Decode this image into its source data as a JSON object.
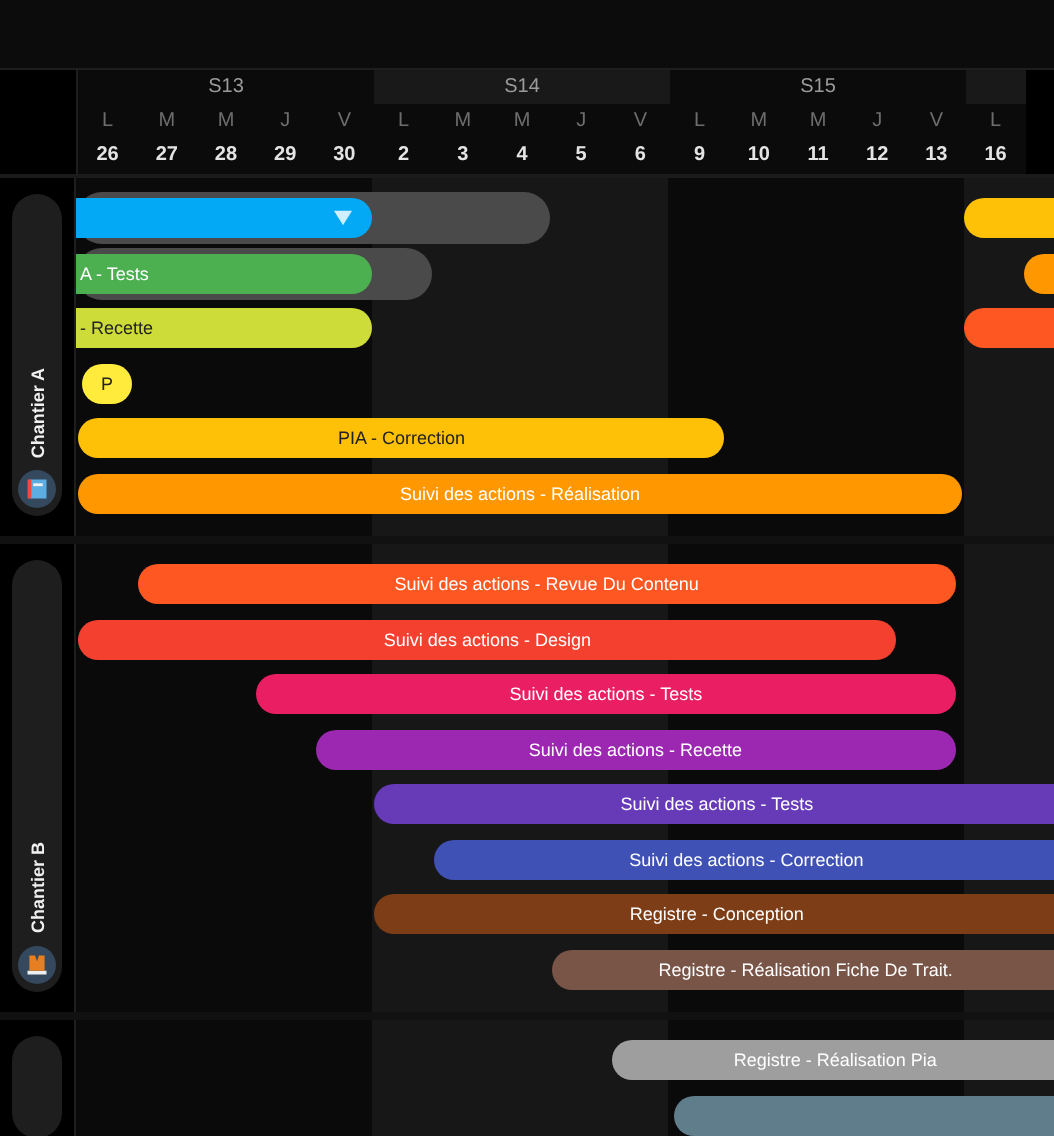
{
  "timeline": {
    "weeks": [
      {
        "label": "S13",
        "days": [
          {
            "letter": "L",
            "number": "26"
          },
          {
            "letter": "M",
            "number": "27"
          },
          {
            "letter": "M",
            "number": "28"
          },
          {
            "letter": "J",
            "number": "29"
          },
          {
            "letter": "V",
            "number": "30"
          }
        ]
      },
      {
        "label": "S14",
        "days": [
          {
            "letter": "L",
            "number": "2"
          },
          {
            "letter": "M",
            "number": "3"
          },
          {
            "letter": "M",
            "number": "4"
          },
          {
            "letter": "J",
            "number": "5"
          },
          {
            "letter": "V",
            "number": "6"
          }
        ]
      },
      {
        "label": "S15",
        "days": [
          {
            "letter": "L",
            "number": "9"
          },
          {
            "letter": "M",
            "number": "10"
          },
          {
            "letter": "M",
            "number": "11"
          },
          {
            "letter": "J",
            "number": "12"
          },
          {
            "letter": "V",
            "number": "13"
          }
        ]
      },
      {
        "days": [
          {
            "letter": "L",
            "number": "16"
          }
        ]
      }
    ]
  },
  "groups": [
    {
      "name": "Chantier A",
      "rows": [
        {
          "bars": [
            {
              "color": "#03a9f4",
              "dropdown": true
            },
            {
              "color": "#ffc107"
            }
          ]
        },
        {
          "bars": [
            {
              "label": "A - Tests",
              "color": "#4caf50"
            },
            {
              "color": "#ff9800"
            }
          ]
        },
        {
          "bars": [
            {
              "label": "- Recette",
              "color": "#cddc39"
            },
            {
              "color": "#ff5722"
            }
          ]
        },
        {
          "bars": [
            {
              "label": "P",
              "color": "#ffeb3b"
            }
          ]
        },
        {
          "bars": [
            {
              "label": "PIA - Correction",
              "color": "#ffc107"
            }
          ]
        },
        {
          "bars": [
            {
              "label": "Suivi des actions - Réalisation",
              "color": "#ff9800"
            }
          ]
        }
      ]
    },
    {
      "name": "Chantier B",
      "rows": [
        {
          "bars": [
            {
              "label": "Suivi des actions - Revue Du Contenu",
              "color": "#ff5722"
            }
          ]
        },
        {
          "bars": [
            {
              "label": "Suivi des actions - Design",
              "color": "#f4402f"
            }
          ]
        },
        {
          "bars": [
            {
              "label": "Suivi des actions - Tests",
              "color": "#e91e63"
            }
          ]
        },
        {
          "bars": [
            {
              "label": "Suivi des actions - Recette",
              "color": "#9c27b0"
            }
          ]
        },
        {
          "bars": [
            {
              "label": "Suivi des actions - Tests",
              "color": "#673ab7"
            }
          ]
        },
        {
          "bars": [
            {
              "label": "Suivi des actions - Correction",
              "color": "#3f51b5"
            }
          ]
        },
        {
          "bars": [
            {
              "label": "Registre - Conception",
              "color": "#7d3e17"
            }
          ]
        },
        {
          "bars": [
            {
              "label": "Registre - Réalisation Fiche De Trait.",
              "color": "#795548"
            }
          ]
        }
      ]
    },
    {
      "rows": [
        {
          "bars": [
            {
              "label": "Registre - Réalisation Pia",
              "color": "#9e9e9e"
            }
          ]
        },
        {
          "bars": [
            {
              "color": "#607d8b"
            }
          ]
        }
      ]
    }
  ]
}
